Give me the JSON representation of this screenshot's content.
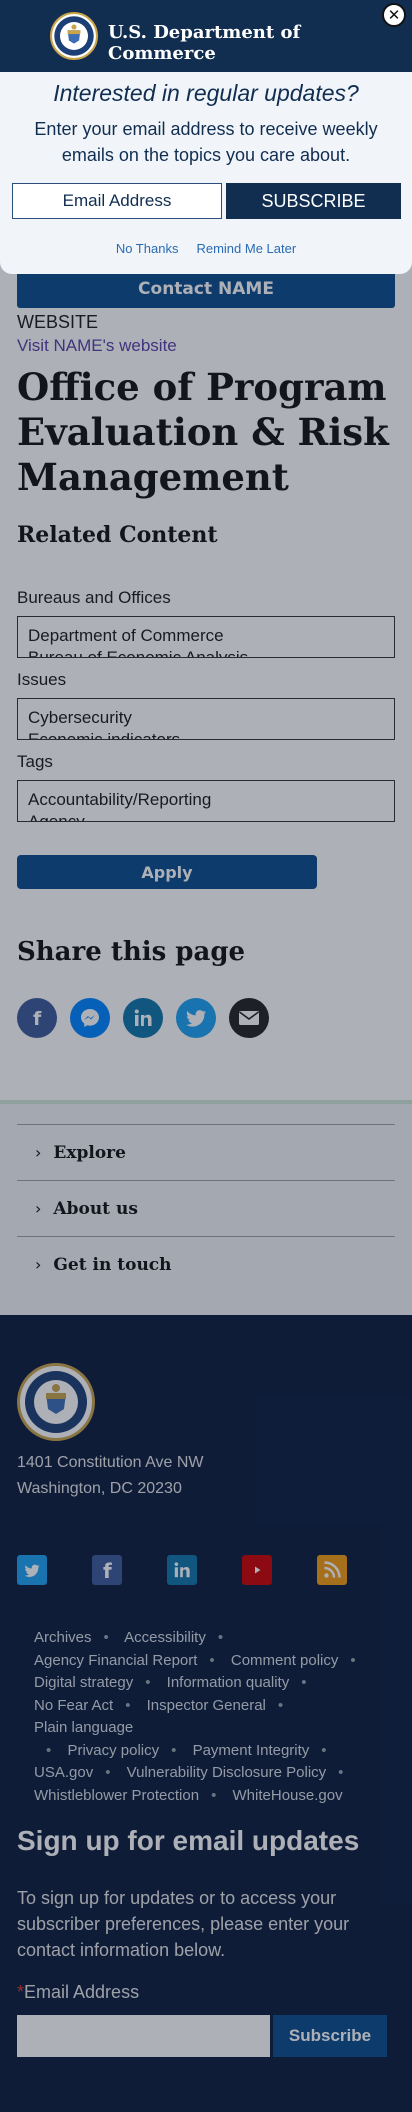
{
  "header": {
    "title": "U.S. Department of Commerce"
  },
  "modal": {
    "heading": "Interested in regular updates?",
    "description": "Enter your email address to receive weekly emails on the topics you care about.",
    "email_placeholder": "Email Address",
    "subscribe_label": "SUBSCRIBE",
    "no_thanks": "No Thanks",
    "remind_later": "Remind Me Later",
    "close_glyph": "✕"
  },
  "contact": {
    "button_label": "Contact NAME",
    "website_label": "WEBSITE",
    "website_link": "Visit NAME's website"
  },
  "page_title": "Office of Program Evaluation & Risk Management",
  "related": {
    "title": "Related Content",
    "facets": [
      {
        "label": "Bureaus and Offices",
        "options": [
          "Department of Commerce",
          "Bureau of Economic Analysis"
        ]
      },
      {
        "label": "Issues",
        "options": [
          "Cybersecurity",
          "Economic indicators"
        ]
      },
      {
        "label": "Tags",
        "options": [
          "Accountability/Reporting",
          "Agency"
        ]
      }
    ],
    "apply_label": "Apply"
  },
  "share": {
    "title": "Share this page"
  },
  "accordion": [
    "Explore",
    "About us",
    "Get in touch"
  ],
  "footer": {
    "address_line1": "1401 Constitution Ave NW",
    "address_line2": "Washington, DC 20230",
    "links": [
      "Archives",
      "Accessibility",
      "Agency Financial Report",
      "Comment policy",
      "Digital strategy",
      "Information quality",
      "No Fear Act",
      "Inspector General",
      "Plain language",
      "Privacy policy",
      "Payment Integrity",
      "USA.gov",
      "Vulnerability Disclosure Policy",
      "Whistleblower Protection",
      "WhiteHouse.gov"
    ],
    "signup_title": "Sign up for email updates",
    "signup_desc": "To sign up for updates or to access your subscriber preferences, please enter your contact information below.",
    "email_required_mark": "*",
    "email_label": "Email Address",
    "subscribe_label": "Subscribe"
  },
  "colors": {
    "navy": "#112e51",
    "primary_blue": "#0a4c8a",
    "footer_bg": "#0b1d3d",
    "facebook": "#3b5998",
    "messenger": "#0084ff",
    "linkedin": "#0e76a8",
    "twitter": "#1da1f2",
    "youtube": "#cc0000",
    "rss": "#f39c12"
  }
}
